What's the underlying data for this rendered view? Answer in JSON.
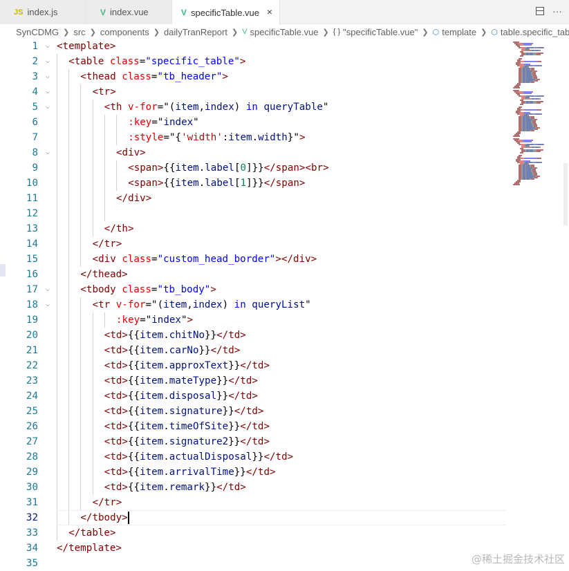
{
  "tabs": [
    {
      "label": "index.js",
      "icon": "js-file-icon",
      "active": false
    },
    {
      "label": "index.vue",
      "icon": "vue-file-icon",
      "active": false
    },
    {
      "label": "specificTable.vue",
      "icon": "vue-file-icon",
      "active": true
    }
  ],
  "tab_icon_glyphs": {
    "js": "JS",
    "vue": "V",
    "close": "×",
    "more": "···"
  },
  "breadcrumb": {
    "items": [
      "SynCDMG",
      "src",
      "components",
      "dailyTranReport",
      "specificTable.vue",
      "\"specificTable.vue\"",
      "template",
      "table.specific_table"
    ],
    "brace_glyph": "{ }"
  },
  "editor": {
    "current_line": 32,
    "lines": [
      {
        "n": "1",
        "indent": 0,
        "tokens": [
          [
            "t",
            "<template>"
          ]
        ]
      },
      {
        "n": "2",
        "indent": 1,
        "tokens": [
          [
            "t",
            "<table"
          ],
          [
            "p",
            " "
          ],
          [
            "a",
            "class"
          ],
          [
            "p",
            "="
          ],
          [
            "s",
            "\"specific_table\""
          ],
          [
            "t",
            ">"
          ]
        ]
      },
      {
        "n": "3",
        "indent": 2,
        "tokens": [
          [
            "t",
            "<thead"
          ],
          [
            "p",
            " "
          ],
          [
            "a",
            "class"
          ],
          [
            "p",
            "="
          ],
          [
            "s",
            "\"tb_header\""
          ],
          [
            "t",
            ">"
          ]
        ]
      },
      {
        "n": "4",
        "indent": 3,
        "tokens": [
          [
            "t",
            "<tr>"
          ]
        ]
      },
      {
        "n": "5",
        "indent": 4,
        "tokens": [
          [
            "t",
            "<th"
          ],
          [
            "p",
            " "
          ],
          [
            "a",
            "v-for"
          ],
          [
            "p",
            "=\""
          ],
          [
            "p",
            "("
          ],
          [
            "v",
            "item"
          ],
          [
            "p",
            ","
          ],
          [
            "v",
            "index"
          ],
          [
            "p",
            ")"
          ],
          [
            "p",
            " "
          ],
          [
            "s",
            "in"
          ],
          [
            "p",
            " "
          ],
          [
            "v",
            "queryTable"
          ],
          [
            "p",
            "\""
          ]
        ]
      },
      {
        "n": "6",
        "indent": 6,
        "tokens": [
          [
            "a",
            ":key"
          ],
          [
            "p",
            "=\""
          ],
          [
            "v",
            "index"
          ],
          [
            "p",
            "\""
          ]
        ]
      },
      {
        "n": "7",
        "indent": 6,
        "tokens": [
          [
            "a",
            ":style"
          ],
          [
            "p",
            "=\""
          ],
          [
            "p",
            "{"
          ],
          [
            "st",
            "'width'"
          ],
          [
            "p",
            ":"
          ],
          [
            "v",
            "item"
          ],
          [
            "p",
            "."
          ],
          [
            "v",
            "width"
          ],
          [
            "p",
            "}\""
          ],
          [
            "t",
            ">"
          ]
        ]
      },
      {
        "n": "8",
        "indent": 5,
        "tokens": [
          [
            "t",
            "<div>"
          ]
        ]
      },
      {
        "n": "9",
        "indent": 6,
        "tokens": [
          [
            "t",
            "<span>"
          ],
          [
            "p",
            "{{"
          ],
          [
            "v",
            "item"
          ],
          [
            "p",
            "."
          ],
          [
            "v",
            "label"
          ],
          [
            "p",
            "["
          ],
          [
            "n",
            "0"
          ],
          [
            "p",
            "]}}"
          ],
          [
            "t",
            "</span><br>"
          ]
        ]
      },
      {
        "n": "10",
        "indent": 6,
        "tokens": [
          [
            "t",
            "<span>"
          ],
          [
            "p",
            "{{"
          ],
          [
            "v",
            "item"
          ],
          [
            "p",
            "."
          ],
          [
            "v",
            "label"
          ],
          [
            "p",
            "["
          ],
          [
            "n",
            "1"
          ],
          [
            "p",
            "]}}"
          ],
          [
            "t",
            "</span>"
          ]
        ]
      },
      {
        "n": "11",
        "indent": 5,
        "tokens": [
          [
            "t",
            "</div>"
          ]
        ]
      },
      {
        "n": "12",
        "indent": 5,
        "tokens": []
      },
      {
        "n": "13",
        "indent": 4,
        "tokens": [
          [
            "t",
            "</th>"
          ]
        ]
      },
      {
        "n": "14",
        "indent": 3,
        "tokens": [
          [
            "t",
            "</tr>"
          ]
        ]
      },
      {
        "n": "15",
        "indent": 3,
        "tokens": [
          [
            "t",
            "<div"
          ],
          [
            "p",
            " "
          ],
          [
            "a",
            "class"
          ],
          [
            "p",
            "="
          ],
          [
            "s",
            "\"custom_head_border\""
          ],
          [
            "t",
            "></div>"
          ]
        ]
      },
      {
        "n": "16",
        "indent": 2,
        "tokens": [
          [
            "t",
            "</thead>"
          ]
        ]
      },
      {
        "n": "17",
        "indent": 2,
        "tokens": [
          [
            "t",
            "<tbody"
          ],
          [
            "p",
            " "
          ],
          [
            "a",
            "class"
          ],
          [
            "p",
            "="
          ],
          [
            "s",
            "\"tb_body\""
          ],
          [
            "t",
            ">"
          ]
        ]
      },
      {
        "n": "18",
        "indent": 3,
        "tokens": [
          [
            "t",
            "<tr"
          ],
          [
            "p",
            " "
          ],
          [
            "a",
            "v-for"
          ],
          [
            "p",
            "=\""
          ],
          [
            "p",
            "("
          ],
          [
            "v",
            "item"
          ],
          [
            "p",
            ","
          ],
          [
            "v",
            "index"
          ],
          [
            "p",
            ")"
          ],
          [
            "p",
            " "
          ],
          [
            "s",
            "in"
          ],
          [
            "p",
            " "
          ],
          [
            "v",
            "queryList"
          ],
          [
            "p",
            "\""
          ]
        ]
      },
      {
        "n": "19",
        "indent": 5,
        "tokens": [
          [
            "a",
            ":key"
          ],
          [
            "p",
            "=\""
          ],
          [
            "v",
            "index"
          ],
          [
            "p",
            "\""
          ],
          [
            "t",
            ">"
          ]
        ]
      },
      {
        "n": "20",
        "indent": 4,
        "tokens": [
          [
            "t",
            "<td>"
          ],
          [
            "p",
            "{{"
          ],
          [
            "v",
            "item"
          ],
          [
            "p",
            "."
          ],
          [
            "v",
            "chitNo"
          ],
          [
            "p",
            "}}"
          ],
          [
            "t",
            "</td>"
          ]
        ]
      },
      {
        "n": "21",
        "indent": 4,
        "tokens": [
          [
            "t",
            "<td>"
          ],
          [
            "p",
            "{{"
          ],
          [
            "v",
            "item"
          ],
          [
            "p",
            "."
          ],
          [
            "v",
            "carNo"
          ],
          [
            "p",
            "}}"
          ],
          [
            "t",
            "</td>"
          ]
        ]
      },
      {
        "n": "22",
        "indent": 4,
        "tokens": [
          [
            "t",
            "<td>"
          ],
          [
            "p",
            "{{"
          ],
          [
            "v",
            "item"
          ],
          [
            "p",
            "."
          ],
          [
            "v",
            "approxText"
          ],
          [
            "p",
            "}}"
          ],
          [
            "t",
            "</td>"
          ]
        ]
      },
      {
        "n": "23",
        "indent": 4,
        "tokens": [
          [
            "t",
            "<td>"
          ],
          [
            "p",
            "{{"
          ],
          [
            "v",
            "item"
          ],
          [
            "p",
            "."
          ],
          [
            "v",
            "mateType"
          ],
          [
            "p",
            "}}"
          ],
          [
            "t",
            "</td>"
          ]
        ]
      },
      {
        "n": "24",
        "indent": 4,
        "tokens": [
          [
            "t",
            "<td>"
          ],
          [
            "p",
            "{{"
          ],
          [
            "v",
            "item"
          ],
          [
            "p",
            "."
          ],
          [
            "v",
            "disposal"
          ],
          [
            "p",
            "}}"
          ],
          [
            "t",
            "</td>"
          ]
        ]
      },
      {
        "n": "25",
        "indent": 4,
        "tokens": [
          [
            "t",
            "<td>"
          ],
          [
            "p",
            "{{"
          ],
          [
            "v",
            "item"
          ],
          [
            "p",
            "."
          ],
          [
            "v",
            "signature"
          ],
          [
            "p",
            "}}"
          ],
          [
            "t",
            "</td>"
          ]
        ]
      },
      {
        "n": "26",
        "indent": 4,
        "tokens": [
          [
            "t",
            "<td>"
          ],
          [
            "p",
            "{{"
          ],
          [
            "v",
            "item"
          ],
          [
            "p",
            "."
          ],
          [
            "v",
            "timeOfSite"
          ],
          [
            "p",
            "}}"
          ],
          [
            "t",
            "</td>"
          ]
        ]
      },
      {
        "n": "27",
        "indent": 4,
        "tokens": [
          [
            "t",
            "<td>"
          ],
          [
            "p",
            "{{"
          ],
          [
            "v",
            "item"
          ],
          [
            "p",
            "."
          ],
          [
            "v",
            "signature2"
          ],
          [
            "p",
            "}}"
          ],
          [
            "t",
            "</td>"
          ]
        ]
      },
      {
        "n": "28",
        "indent": 4,
        "tokens": [
          [
            "t",
            "<td>"
          ],
          [
            "p",
            "{{"
          ],
          [
            "v",
            "item"
          ],
          [
            "p",
            "."
          ],
          [
            "v",
            "actualDisposal"
          ],
          [
            "p",
            "}}"
          ],
          [
            "t",
            "</td>"
          ]
        ]
      },
      {
        "n": "29",
        "indent": 4,
        "tokens": [
          [
            "t",
            "<td>"
          ],
          [
            "p",
            "{{"
          ],
          [
            "v",
            "item"
          ],
          [
            "p",
            "."
          ],
          [
            "v",
            "arrivalTime"
          ],
          [
            "p",
            "}}"
          ],
          [
            "t",
            "</td>"
          ]
        ]
      },
      {
        "n": "30",
        "indent": 4,
        "tokens": [
          [
            "t",
            "<td>"
          ],
          [
            "p",
            "{{"
          ],
          [
            "v",
            "item"
          ],
          [
            "p",
            "."
          ],
          [
            "v",
            "remark"
          ],
          [
            "p",
            "}}"
          ],
          [
            "t",
            "</td>"
          ]
        ]
      },
      {
        "n": "31",
        "indent": 3,
        "tokens": [
          [
            "t",
            "</tr>"
          ]
        ]
      },
      {
        "n": "32",
        "indent": 2,
        "tokens": [
          [
            "t",
            "</tbody>"
          ]
        ]
      },
      {
        "n": "33",
        "indent": 1,
        "tokens": [
          [
            "t",
            "</table>"
          ]
        ]
      },
      {
        "n": "34",
        "indent": 0,
        "tokens": [
          [
            "t",
            "</template>"
          ]
        ]
      },
      {
        "n": "35",
        "indent": 0,
        "tokens": []
      }
    ]
  },
  "watermark": "@稀土掘金技术社区",
  "colors": {
    "tag": "#800000",
    "attr": "#e50000",
    "string": "#0000ff",
    "keyword": "#af00db",
    "variable": "#001080",
    "number": "#098658",
    "line_number": "#237893"
  }
}
